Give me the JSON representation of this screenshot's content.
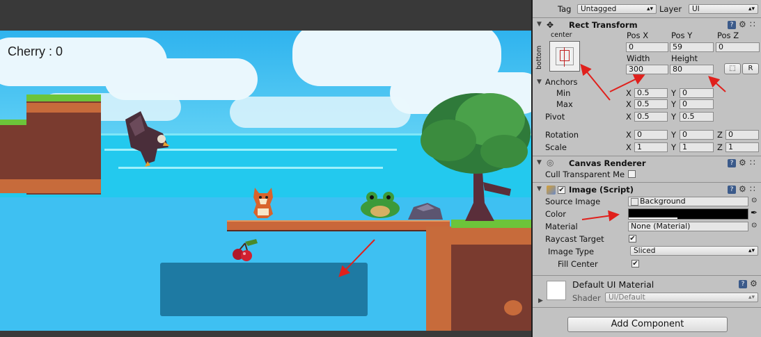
{
  "game": {
    "hud_text": "Cherry : 0"
  },
  "inspector": {
    "tag_label": "Tag",
    "tag_value": "Untagged",
    "layer_label": "Layer",
    "layer_value": "UI",
    "rect_transform": {
      "title": "Rect Transform",
      "anchor_h": "center",
      "anchor_v": "bottom",
      "pos_x_label": "Pos X",
      "pos_y_label": "Pos Y",
      "pos_z_label": "Pos Z",
      "pos_x": "0",
      "pos_y": "59",
      "pos_z": "0",
      "width_label": "Width",
      "height_label": "Height",
      "width": "300",
      "height": "80",
      "r_button": "R",
      "anchors_label": "Anchors",
      "min_label": "Min",
      "max_label": "Max",
      "min_x": "0.5",
      "min_y": "0",
      "max_x": "0.5",
      "max_y": "0",
      "pivot_label": "Pivot",
      "pivot_x": "0.5",
      "pivot_y": "0.5",
      "rotation_label": "Rotation",
      "rot_x": "0",
      "rot_y": "0",
      "rot_z": "0",
      "scale_label": "Scale",
      "scale_x": "1",
      "scale_y": "1",
      "scale_z": "1",
      "x": "X",
      "y": "Y",
      "z": "Z"
    },
    "canvas_renderer": {
      "title": "Canvas Renderer",
      "cull_label": "Cull Transparent Me"
    },
    "image": {
      "title": "Image (Script)",
      "source_label": "Source Image",
      "source_value": "Background",
      "color_label": "Color",
      "color_value": "#000000",
      "material_label": "Material",
      "material_value": "None (Material)",
      "raycast_label": "Raycast Target",
      "image_type_label": "Image Type",
      "image_type_value": "Sliced",
      "fill_center_label": "Fill Center"
    },
    "material": {
      "name": "Default UI Material",
      "shader_label": "Shader",
      "shader_value": "UI/Default"
    },
    "add_component": "Add Component"
  },
  "colors": {
    "annotation_arrow": "#e0201c",
    "ui_panel": "#1e7aa3",
    "inspector_bg": "#c2c2c2"
  }
}
